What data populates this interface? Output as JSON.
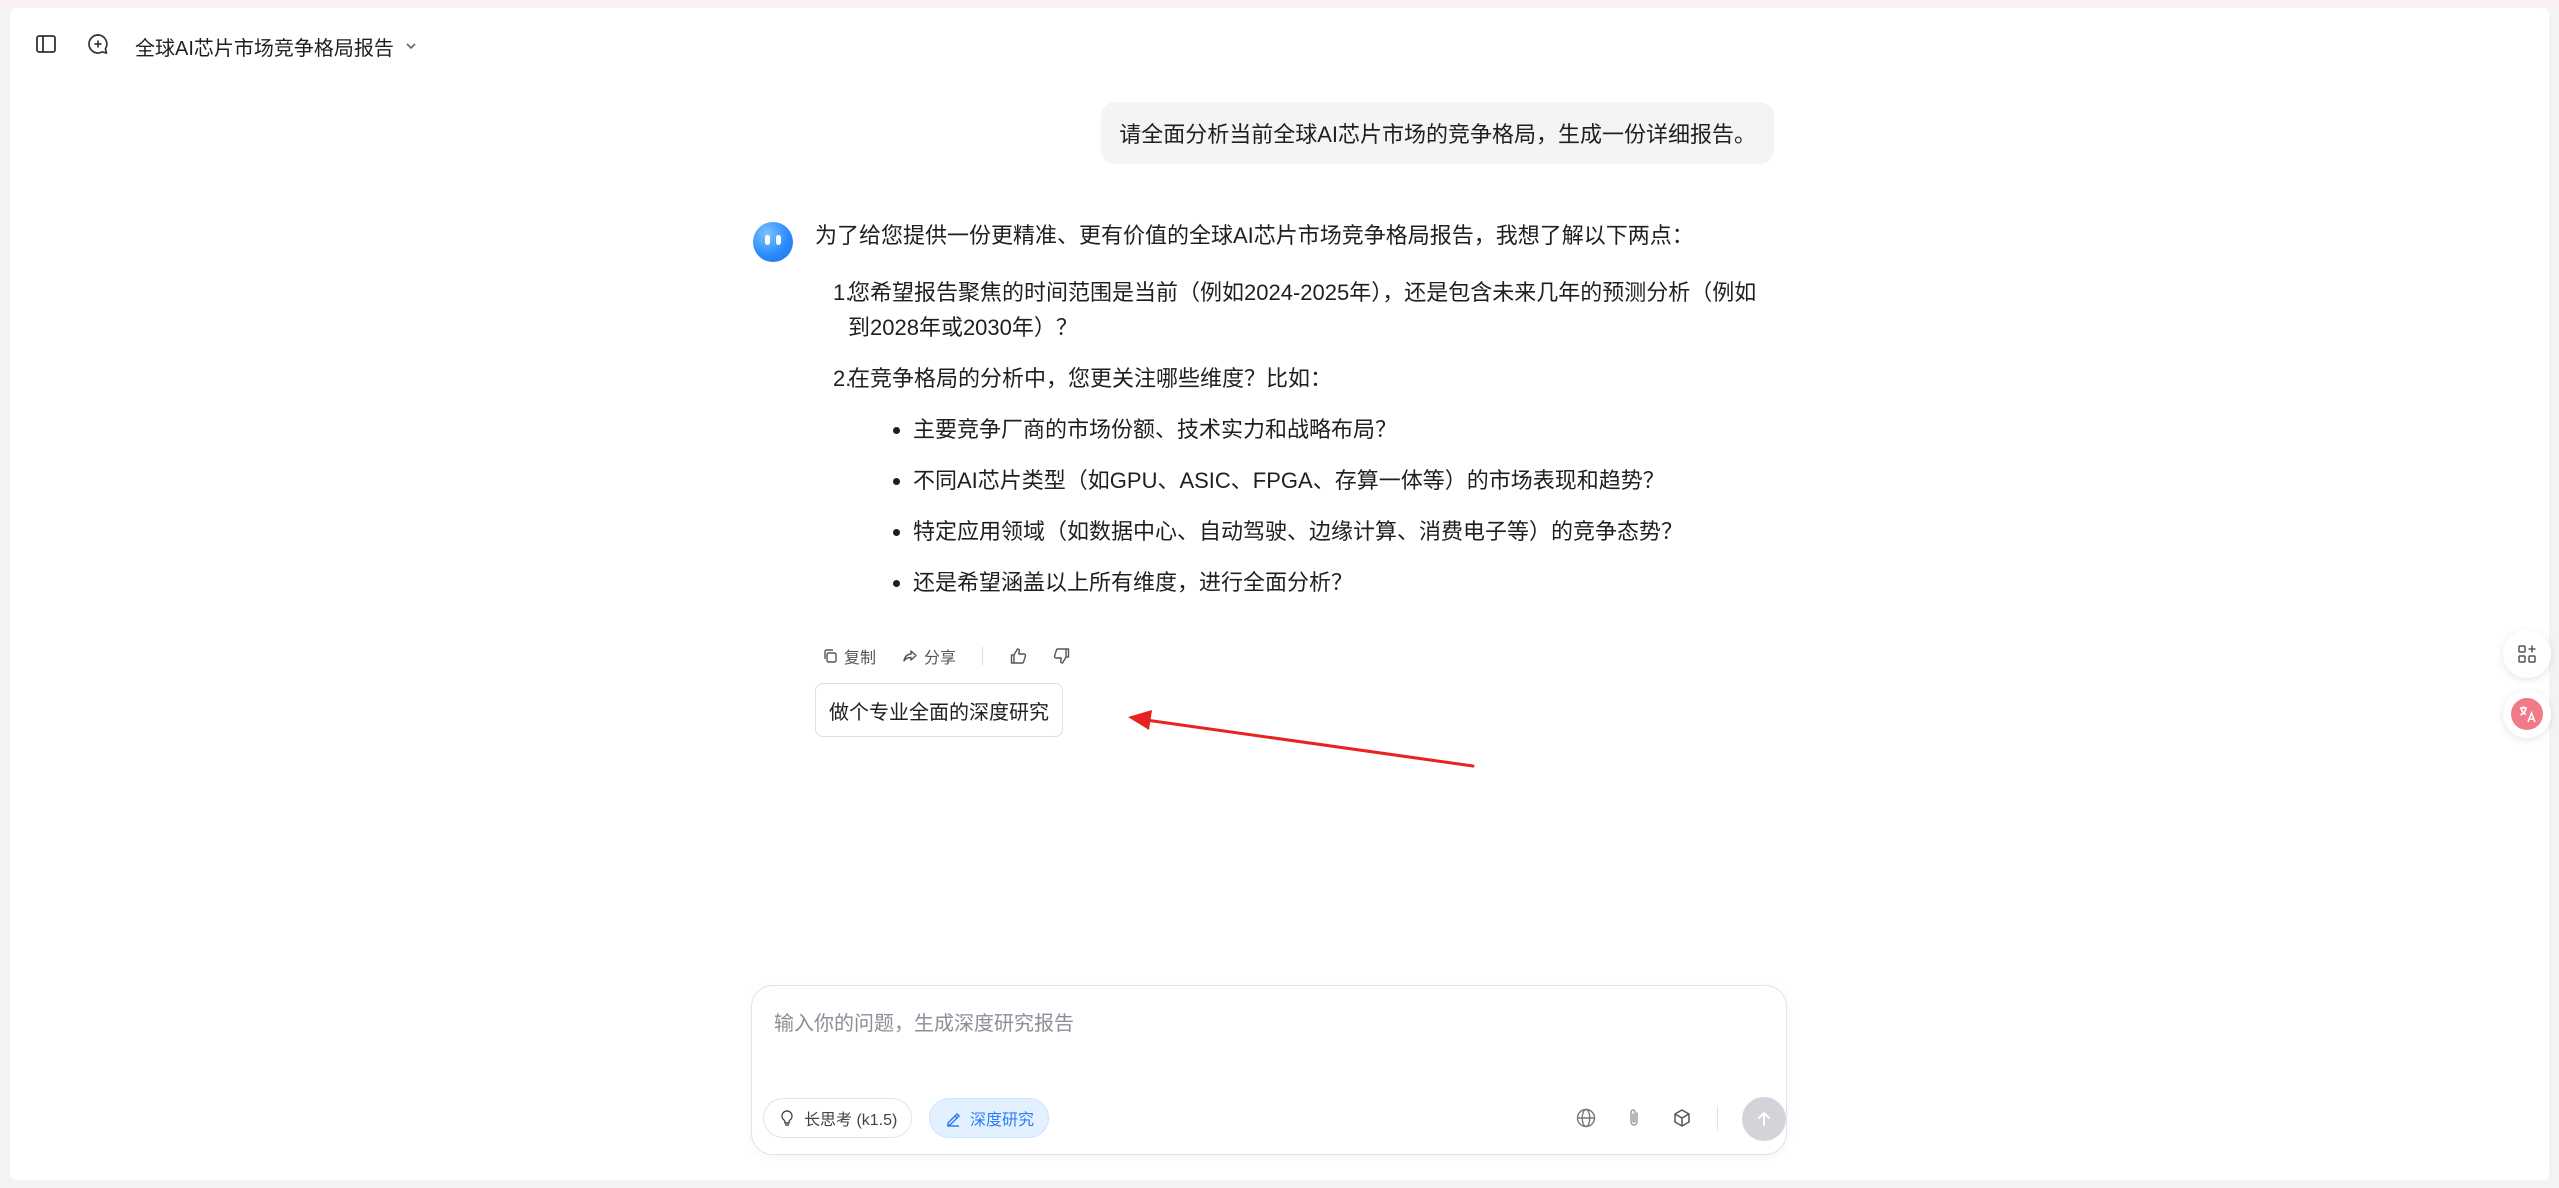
{
  "header": {
    "title": "全球AI芯片市场竞争格局报告",
    "sidebar_icon": "sidebar-toggle-icon",
    "new_chat_icon": "new-chat-icon"
  },
  "user_message": "请全面分析当前全球AI芯片市场的竞争格局，生成一份详细报告。",
  "assistant": {
    "intro": "为了给您提供一份更精准、更有价值的全球AI芯片市场竞争格局报告，我想了解以下两点：",
    "items": [
      {
        "num": "1.",
        "text": "您希望报告聚焦的时间范围是当前（例如2024-2025年），还是包含未来几年的预测分析（例如到2028年或2030年）？"
      },
      {
        "num": "2.",
        "text": "在竞争格局的分析中，您更关注哪些维度？比如："
      }
    ],
    "bullets": [
      "主要竞争厂商的市场份额、技术实力和战略布局？",
      "不同AI芯片类型（如GPU、ASIC、FPGA、存算一体等）的市场表现和趋势？",
      "特定应用领域（如数据中心、自动驾驶、边缘计算、消费电子等）的竞争态势？",
      "还是希望涵盖以上所有维度，进行全面分析？"
    ],
    "actions": {
      "copy": "复制",
      "share": "分享"
    },
    "suggestion": "做个专业全面的深度研究"
  },
  "composer": {
    "placeholder": "输入你的问题，生成深度研究报告",
    "value": "",
    "think_chip": "长思考 (k1.5)",
    "deep_chip": "深度研究"
  },
  "colors": {
    "accent": "#2f7df6",
    "annotation_arrow": "#e8231f"
  }
}
